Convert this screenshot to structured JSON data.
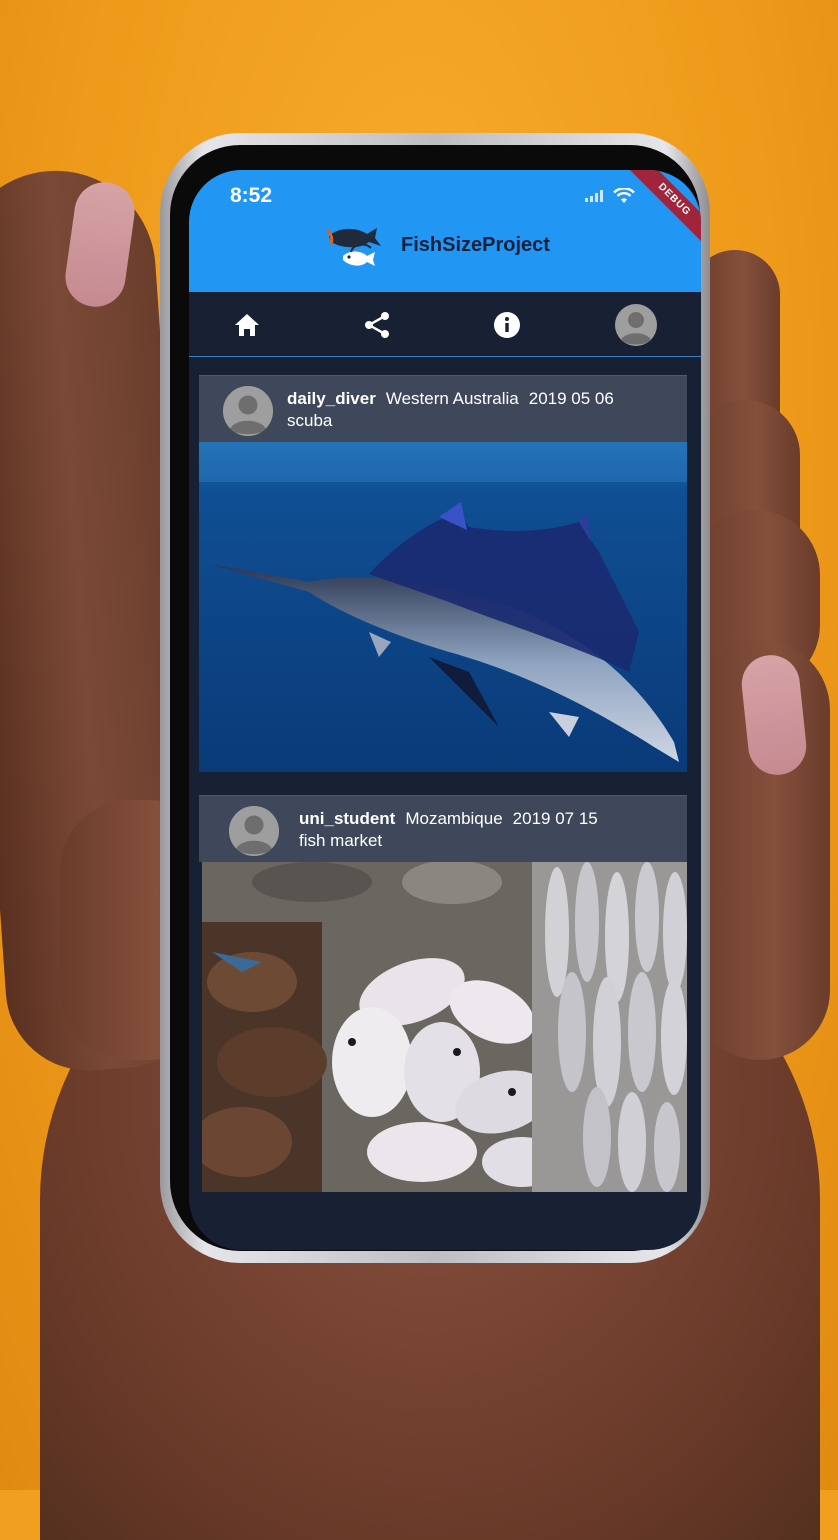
{
  "status_bar": {
    "time": "8:52",
    "debug_label": "DEBUG"
  },
  "app": {
    "title": "FishSizeProject"
  },
  "nav": {
    "items": [
      {
        "name": "home",
        "icon": "home-icon"
      },
      {
        "name": "share",
        "icon": "share-icon"
      },
      {
        "name": "info",
        "icon": "info-icon"
      },
      {
        "name": "profile",
        "icon": "avatar-icon"
      }
    ]
  },
  "posts": [
    {
      "username": "daily_diver",
      "location": "Western Australia",
      "date": "2019 05 06",
      "method": "scuba",
      "image": "sailfish-underwater"
    },
    {
      "username": "uni_student",
      "location": "Mozambique",
      "date": "2019 07 15",
      "method": "fish market",
      "image": "fish-market-catch"
    }
  ],
  "colors": {
    "appbar": "#2196f3",
    "background": "#182033",
    "card_header": "#3f485a",
    "accent_line": "#3a7fc1"
  }
}
